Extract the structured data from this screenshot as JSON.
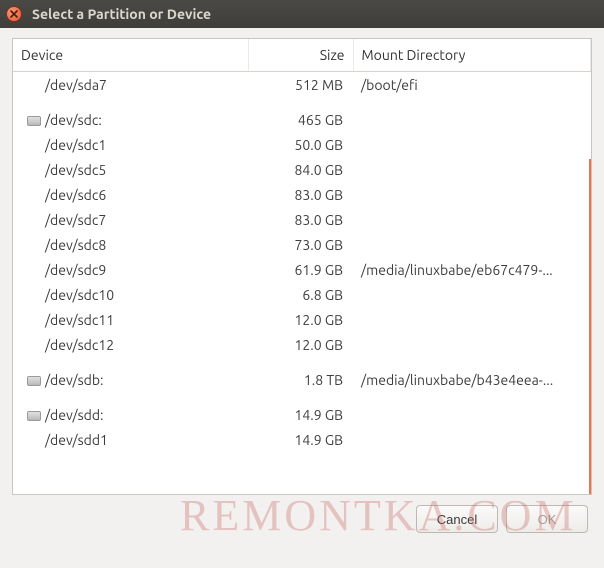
{
  "window": {
    "title": "Select a Partition or Device"
  },
  "columns": {
    "device": "Device",
    "size": "Size",
    "mount": "Mount Directory"
  },
  "rows": [
    {
      "dev": "/dev/sda7",
      "size": "512 MB",
      "mount": "/boot/efi",
      "top": false,
      "is_disk": false
    },
    {
      "spacer": true
    },
    {
      "dev": "/dev/sdc:",
      "size": "465 GB",
      "mount": "",
      "top": true,
      "is_disk": true
    },
    {
      "dev": "/dev/sdc1",
      "size": "50.0 GB",
      "mount": "",
      "top": false,
      "is_disk": false
    },
    {
      "dev": "/dev/sdc5",
      "size": "84.0 GB",
      "mount": "",
      "top": false,
      "is_disk": false
    },
    {
      "dev": "/dev/sdc6",
      "size": "83.0 GB",
      "mount": "",
      "top": false,
      "is_disk": false
    },
    {
      "dev": "/dev/sdc7",
      "size": "83.0 GB",
      "mount": "",
      "top": false,
      "is_disk": false
    },
    {
      "dev": "/dev/sdc8",
      "size": "73.0 GB",
      "mount": "",
      "top": false,
      "is_disk": false
    },
    {
      "dev": "/dev/sdc9",
      "size": "61.9 GB",
      "mount": "/media/linuxbabe/eb67c479-...",
      "top": false,
      "is_disk": false
    },
    {
      "dev": "/dev/sdc10",
      "size": "6.8 GB",
      "mount": "",
      "top": false,
      "is_disk": false
    },
    {
      "dev": "/dev/sdc11",
      "size": "12.0 GB",
      "mount": "",
      "top": false,
      "is_disk": false
    },
    {
      "dev": "/dev/sdc12",
      "size": "12.0 GB",
      "mount": "",
      "top": false,
      "is_disk": false
    },
    {
      "spacer": true
    },
    {
      "dev": "/dev/sdb:",
      "size": "1.8 TB",
      "mount": "/media/linuxbabe/b43e4eea-...",
      "top": true,
      "is_disk": true
    },
    {
      "spacer": true
    },
    {
      "dev": "/dev/sdd:",
      "size": "14.9 GB",
      "mount": "",
      "top": true,
      "is_disk": true
    },
    {
      "dev": "/dev/sdd1",
      "size": "14.9 GB",
      "mount": "",
      "top": false,
      "is_disk": false
    }
  ],
  "buttons": {
    "cancel": "Cancel",
    "ok": "OK"
  },
  "watermark": "REMONTKA.COM"
}
